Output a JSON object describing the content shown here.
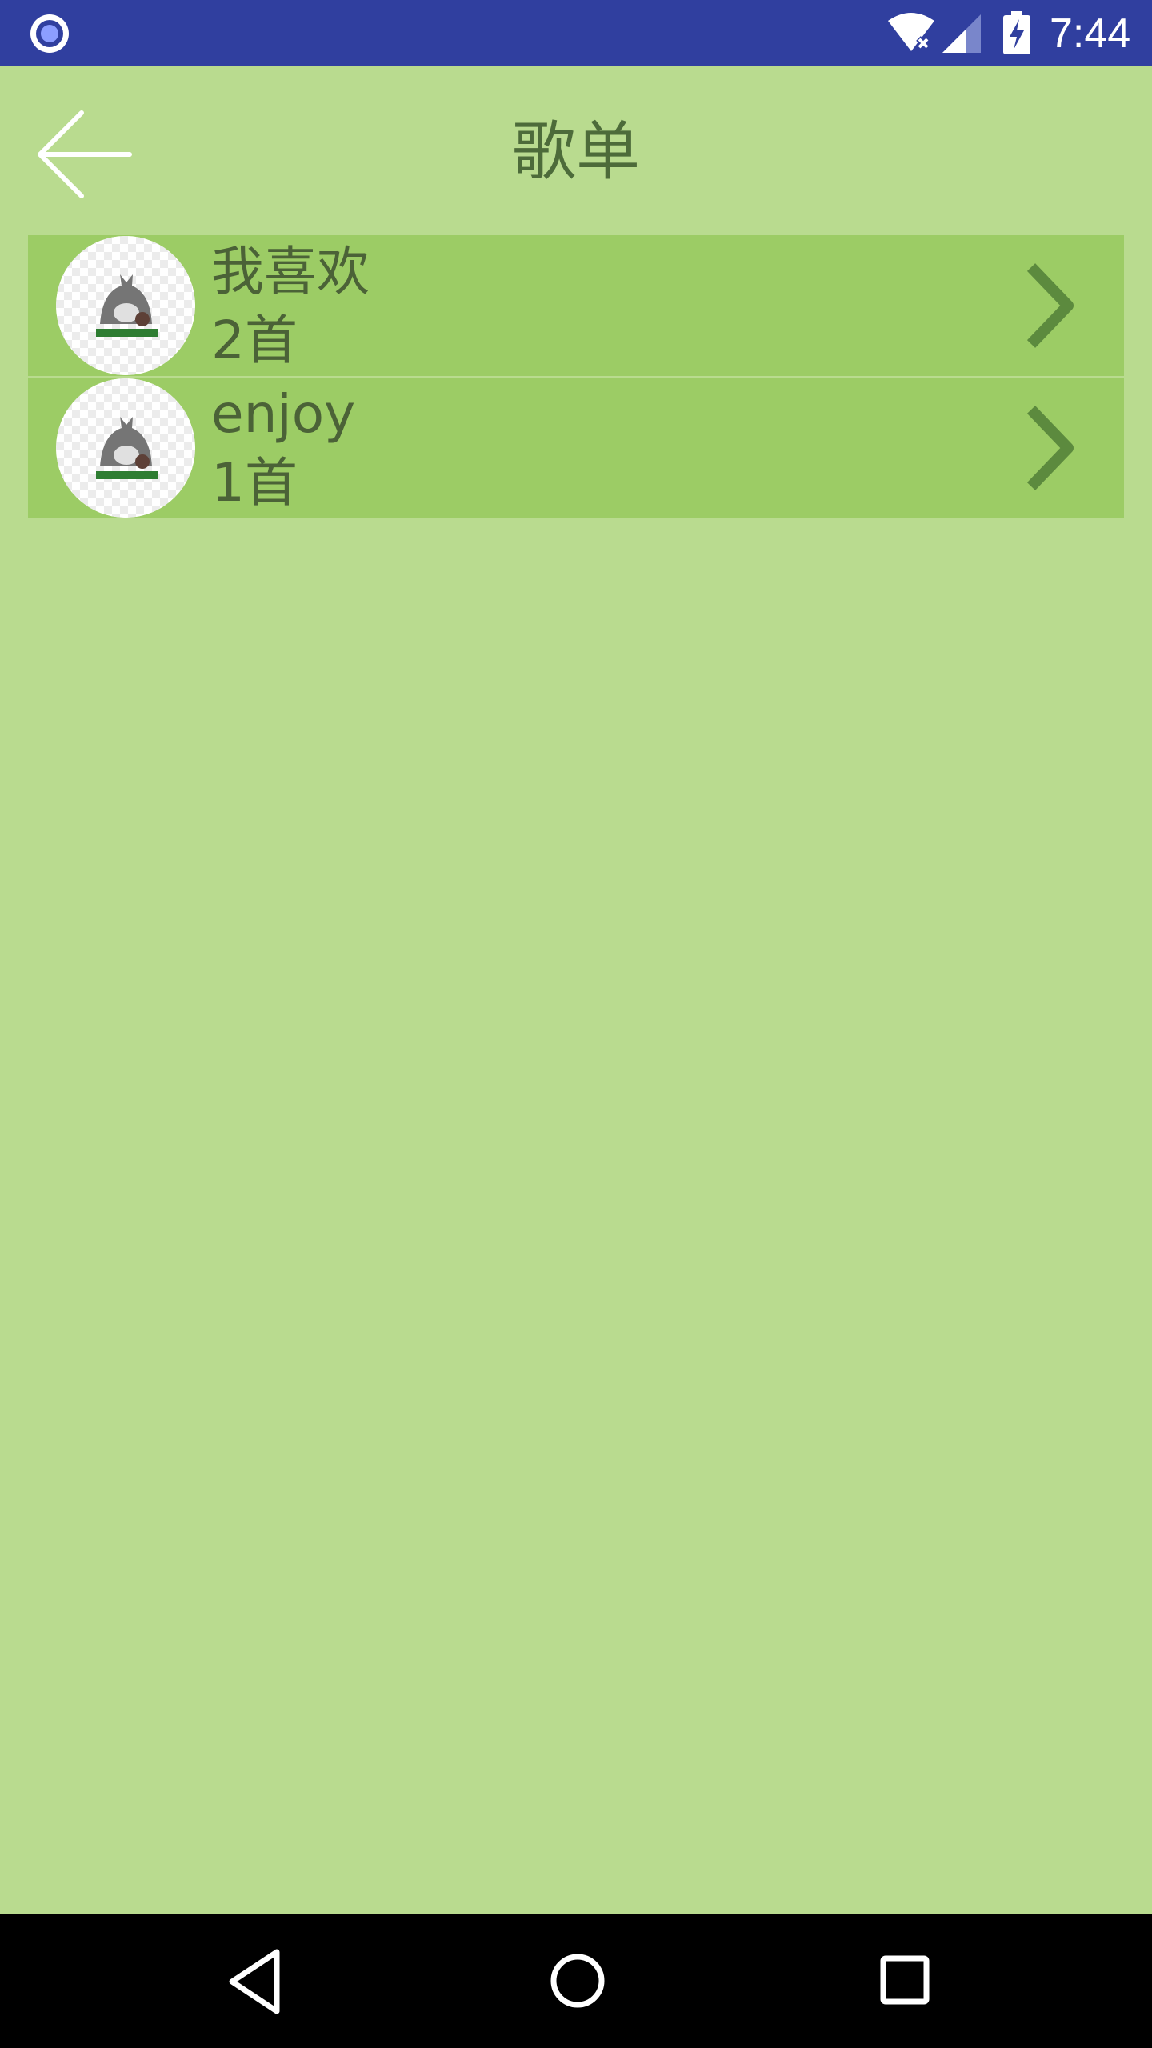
{
  "status_bar": {
    "time": "7:44",
    "icons": [
      "notification-circle-icon",
      "wifi-off-icon",
      "cell-signal-icon",
      "battery-charging-icon"
    ],
    "background": "#303f9f"
  },
  "header": {
    "title": "歌单",
    "back_icon": "arrow-left-icon"
  },
  "playlists": [
    {
      "name": "我喜欢",
      "count": "2首",
      "cover_icon": "totoro-cover-icon",
      "chevron_icon": "chevron-right-icon"
    },
    {
      "name": "enjoy",
      "count": "1首",
      "cover_icon": "totoro-cover-icon",
      "chevron_icon": "chevron-right-icon"
    }
  ],
  "nav_bar": {
    "icons": [
      "nav-back-icon",
      "nav-home-icon",
      "nav-recents-icon"
    ]
  },
  "colors": {
    "page_background": "#b9db8f",
    "row_background": "#9ccc65",
    "text": "#4b6237",
    "nav_bar": "#000000"
  }
}
